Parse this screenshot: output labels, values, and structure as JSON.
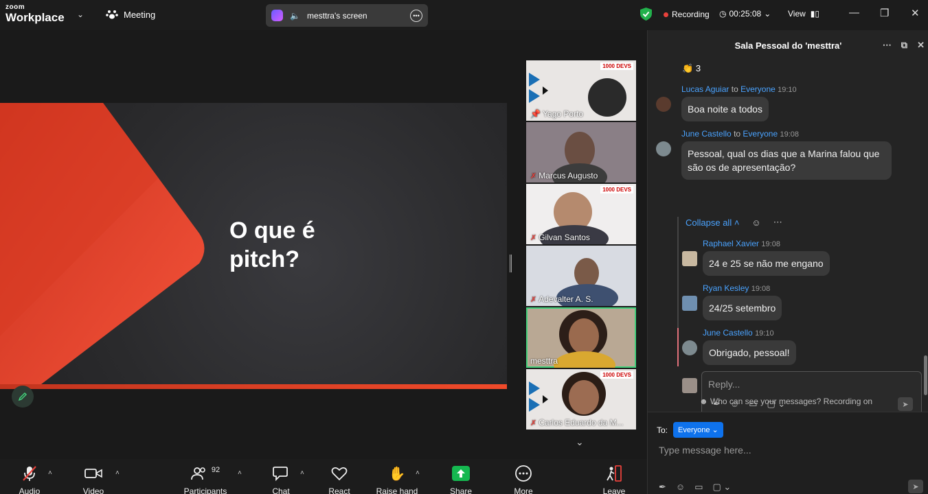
{
  "topbar": {
    "logo_top": "zoom",
    "logo_bottom": "Workplace",
    "meeting_label": "Meeting",
    "share_label": "mesttra's screen",
    "recording_label": "Recording",
    "timer": "00:25:08",
    "view_label": "View"
  },
  "slide": {
    "title": "O que é pitch?"
  },
  "tiles": [
    {
      "name": "Yago Porto",
      "banner": "1000 DEVS"
    },
    {
      "name": "Marcus Augusto"
    },
    {
      "name": "Gilvan Santos",
      "banner": "1000 DEVS"
    },
    {
      "name": "Adevalter A. S."
    },
    {
      "name": "mesttra"
    },
    {
      "name": "Carlos Eduardo da M...",
      "banner": "1000 DEVS"
    }
  ],
  "chat": {
    "title": "Sala Pessoal do 'mesttra'",
    "reaction_count": "3",
    "messages": [
      {
        "sender": "Lucas Aguiar",
        "to": "to",
        "recipient": "Everyone",
        "time": "19:10",
        "text": "Boa noite a todos"
      },
      {
        "sender": "June Castello",
        "to": "to",
        "recipient": "Everyone",
        "time": "19:08",
        "text": "Pessoal, qual os dias que a Marina falou que são os de apresentação?"
      }
    ],
    "collapse_label": "Collapse all",
    "replies": [
      {
        "sender": "Raphael Xavier",
        "time": "19:08",
        "text": "24 e 25 se não me engano"
      },
      {
        "sender": "Ryan Kesley",
        "time": "19:08",
        "text": "24/25 setembro"
      },
      {
        "sender": "June Castello",
        "time": "19:10",
        "text": "Obrigado, pessoal!"
      }
    ],
    "reply_placeholder": "Reply...",
    "privacy_note": "Who can see your messages? Recording on",
    "to_label": "To:",
    "to_value": "Everyone",
    "compose_placeholder": "Type message here..."
  },
  "toolbar": {
    "audio": "Audio",
    "video": "Video",
    "participants": "Participants",
    "participants_count": "92",
    "chat": "Chat",
    "react": "React",
    "raise_hand": "Raise hand",
    "share": "Share",
    "more": "More",
    "leave": "Leave"
  },
  "colors": {
    "accent": "#0e72ed",
    "link": "#4aa3ff",
    "share_green": "#15b850",
    "slide_orange": "#f04a2a",
    "active_tile": "#43d17c"
  }
}
